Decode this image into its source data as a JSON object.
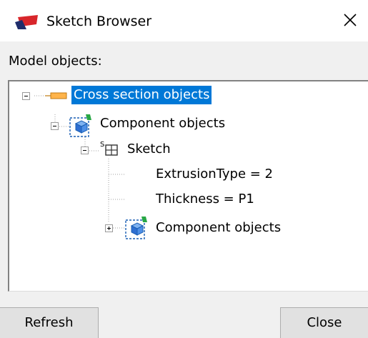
{
  "window": {
    "title": "Sketch Browser",
    "close_glyph": "×",
    "icon": "sketch-app-icon"
  },
  "model_objects_label": "Model objects:",
  "tree": {
    "nodes": [
      {
        "label": "Cross section objects",
        "icon": "cross-section-icon",
        "expander": "collapse",
        "selected": true,
        "level": 0
      },
      {
        "label": "Component objects",
        "icon": "component-icon",
        "expander": "collapse",
        "selected": false,
        "level": 1
      },
      {
        "label": "Sketch",
        "icon": "sketch-icon",
        "expander": "collapse",
        "selected": false,
        "level": 2
      },
      {
        "label": "ExtrusionType = 2",
        "icon": null,
        "expander": null,
        "selected": false,
        "level": 3
      },
      {
        "label": "Thickness = P1",
        "icon": null,
        "expander": null,
        "selected": false,
        "level": 3
      },
      {
        "label": "Component objects",
        "icon": "component-icon",
        "expander": "expand",
        "selected": false,
        "level": 3
      }
    ]
  },
  "buttons": {
    "refresh": "Refresh",
    "close": "Close"
  },
  "colors": {
    "selection": "#0078d7",
    "window_bg": "#f0f0f0",
    "accent_red": "#d8262b"
  }
}
